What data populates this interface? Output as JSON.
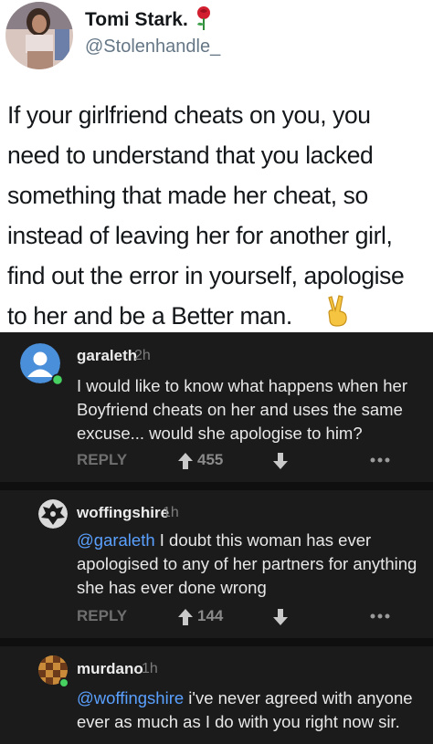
{
  "tweet": {
    "name": "Tomi Stark.",
    "handle": "@Stolenhandle_",
    "text": "If your girlfriend cheats on you, you\nneed to understand that you lacked\nsomething that made her cheat, so\ninstead of leaving her for another girl,\nfind out the error in yourself, apologise\nto her and be a Better man.",
    "name_emoji": "rose-icon",
    "end_emoji": "victory-hand-icon"
  },
  "comments": [
    {
      "author": "garaleth",
      "age": "2h",
      "text": "I would like to know what happens when her Boyfriend cheats on her and uses the same excuse... would she apologise to him?",
      "reply_label": "REPLY",
      "score": "455",
      "avatar": "default-user-avatar-icon",
      "online_color": "#46d160"
    },
    {
      "author": "woffingshire",
      "age": "1h",
      "mention": "@garaleth",
      "text": " I doubt this woman has ever apologised to any of her partners for anything she has ever done wrong",
      "reply_label": "REPLY",
      "score": "144",
      "avatar": "wolf-crest-avatar-icon"
    },
    {
      "author": "murdano",
      "age": "1h",
      "mention": "@woffingshire",
      "text": " i've never agreed with anyone ever as much as I do with you right now sir.",
      "avatar": "checker-avatar-icon",
      "online_color": "#46d160"
    }
  ],
  "colors": {
    "background": "#1b1b1b",
    "mention": "#5aa0ff",
    "avatar_blue": "#4a8fd9"
  }
}
